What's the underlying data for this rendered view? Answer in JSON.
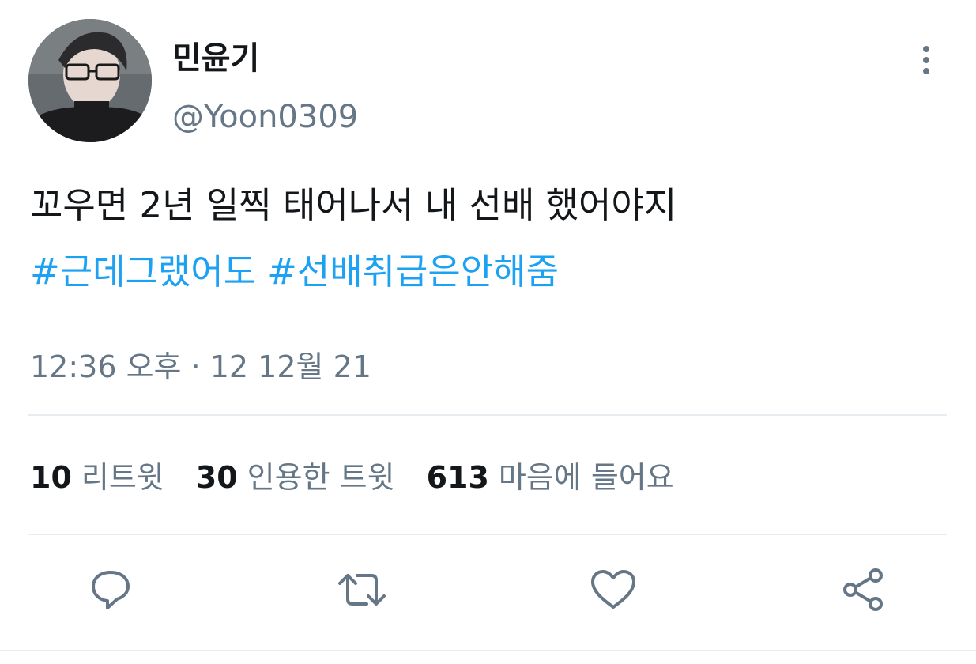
{
  "user": {
    "display_name": "민윤기",
    "handle": "@Yoon0309"
  },
  "tweet": {
    "text": "꼬우면 2년 일찍 태어나서 내 선배 했어야지",
    "hashtags": [
      "#근데그랬어도",
      "#선배취급은안해줌"
    ],
    "timestamp": "12:36 오후 · 12 12월 21"
  },
  "stats": [
    {
      "count": "10",
      "label": "리트윗"
    },
    {
      "count": "30",
      "label": "인용한 트윗"
    },
    {
      "count": "613",
      "label": "마음에 들어요"
    }
  ],
  "actions": {
    "reply_icon": "speech-bubble-icon",
    "retweet_icon": "retweet-arrows-icon",
    "like_icon": "heart-icon",
    "share_icon": "share-nodes-icon"
  },
  "colors": {
    "text": "#14171a",
    "secondary": "#657786",
    "accent": "#1da1f2",
    "divider": "#e6ecf0"
  }
}
